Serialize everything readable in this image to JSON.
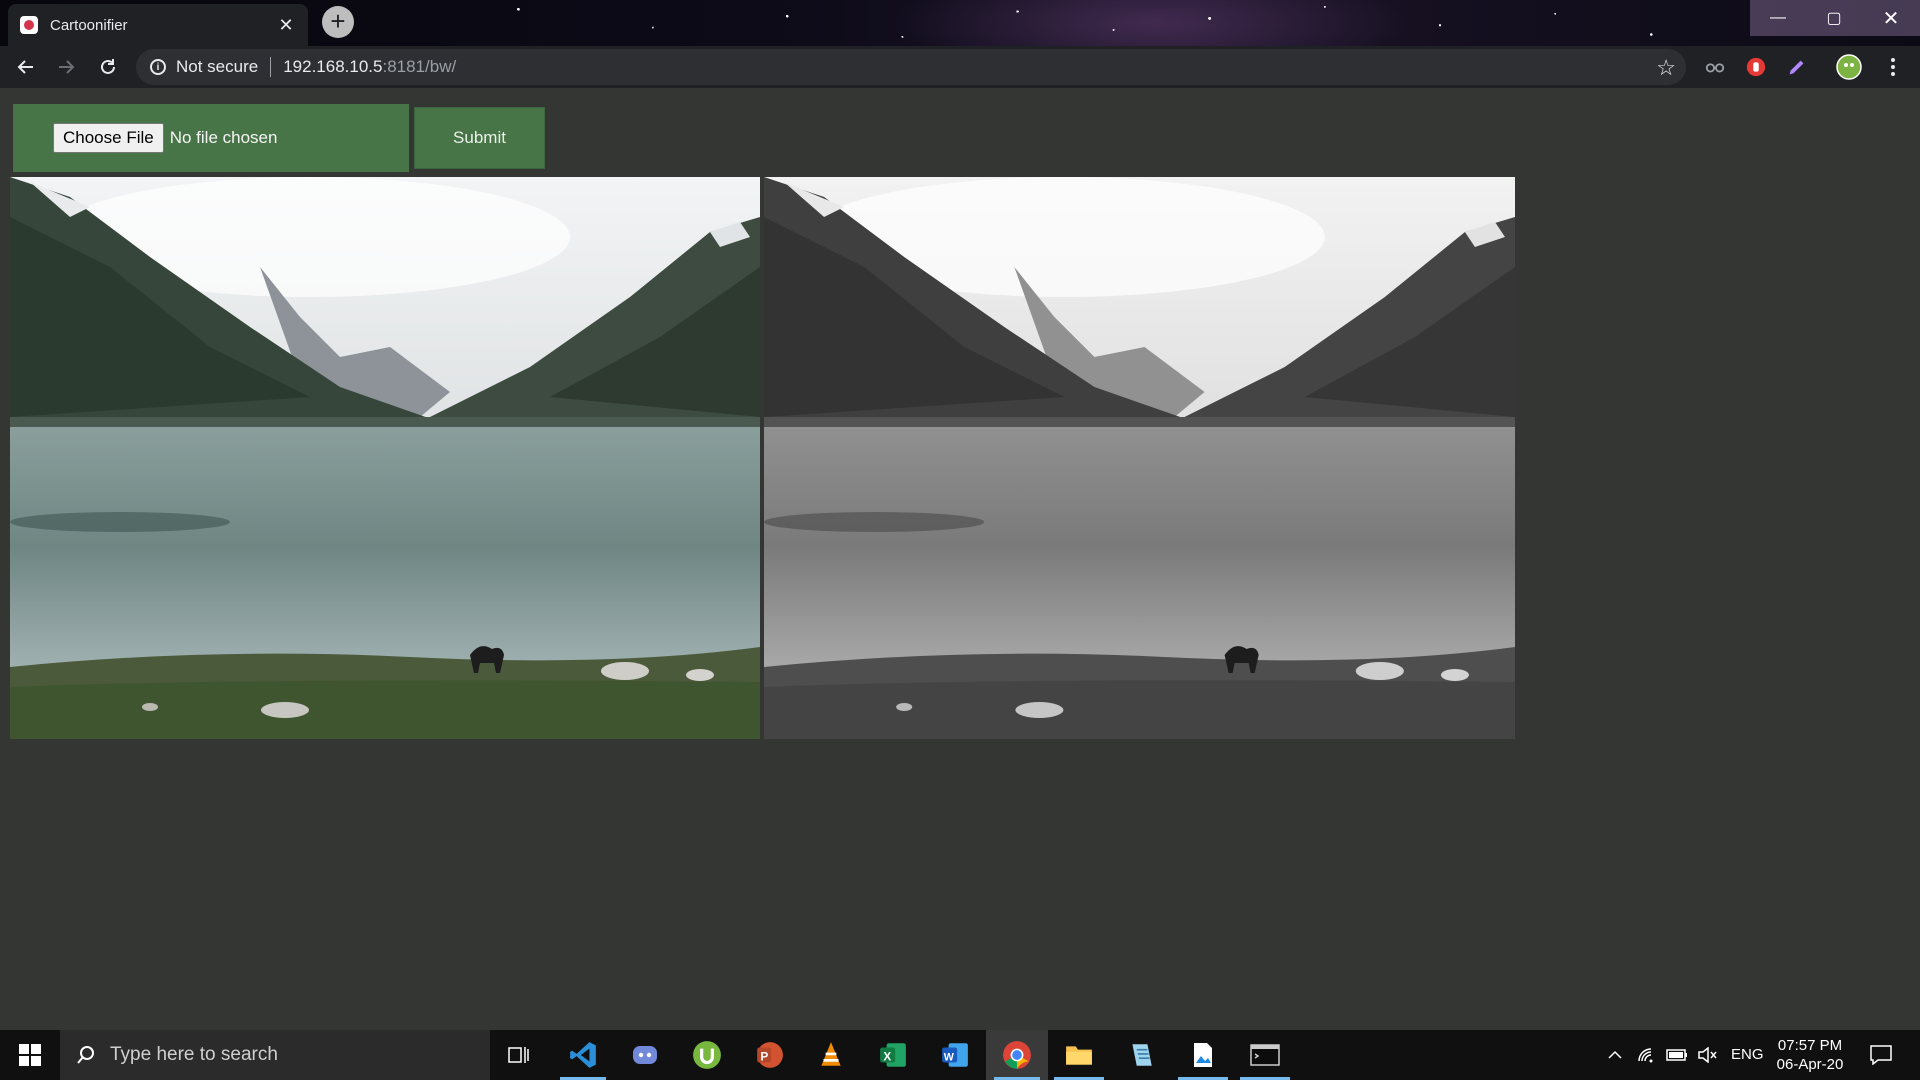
{
  "browser": {
    "tab_title": "Cartoonifier",
    "tab_close": "✕",
    "new_tab": "+",
    "security_label": "Not secure",
    "url_host": "192.168.10.5",
    "url_rest": ":8181/bw/",
    "window_controls": {
      "minimize": "—",
      "maximize": "▢",
      "close": "✕"
    }
  },
  "page": {
    "choose_file_label": "Choose File",
    "file_status": "No file chosen",
    "submit_label": "Submit",
    "images": [
      {
        "kind": "original-color-photo",
        "subject": "mountain-lake-with-dog"
      },
      {
        "kind": "black-and-white-photo",
        "subject": "mountain-lake-with-dog"
      }
    ],
    "accent_color": "#487547"
  },
  "taskbar": {
    "search_placeholder": "Type here to search",
    "apps": [
      "task-view",
      "vscode",
      "discord",
      "utorrent",
      "powerpoint",
      "vlc",
      "excel",
      "word",
      "chrome",
      "file-explorer",
      "notepad",
      "photos",
      "terminal"
    ],
    "tray": {
      "language": "ENG",
      "time": "07:57 PM",
      "date": "06-Apr-20"
    }
  }
}
